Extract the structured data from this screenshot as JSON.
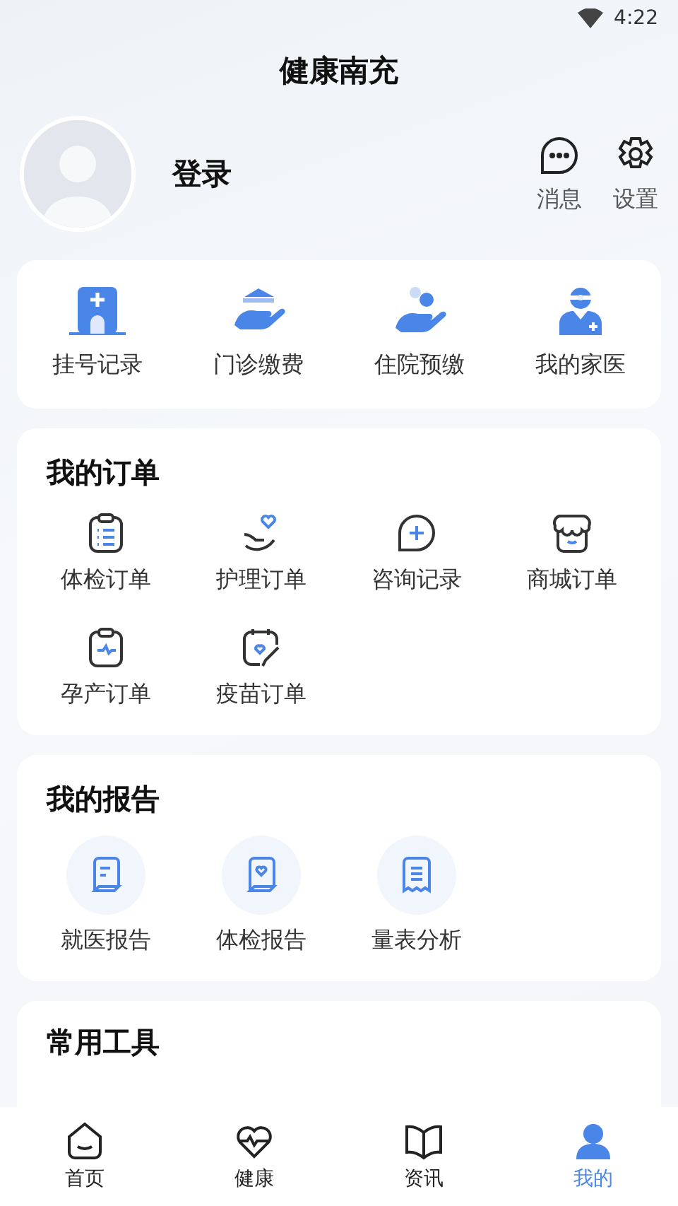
{
  "status_bar": {
    "time": "4:22"
  },
  "title": "健康南充",
  "profile": {
    "login": "登录",
    "actions": [
      {
        "label": "消息"
      },
      {
        "label": "设置"
      }
    ]
  },
  "quick_services": [
    {
      "label": "挂号记录"
    },
    {
      "label": "门诊缴费"
    },
    {
      "label": "住院预缴"
    },
    {
      "label": "我的家医"
    }
  ],
  "orders": {
    "title": "我的订单",
    "items": [
      {
        "label": "体检订单"
      },
      {
        "label": "护理订单"
      },
      {
        "label": "咨询记录"
      },
      {
        "label": "商城订单"
      },
      {
        "label": "孕产订单"
      },
      {
        "label": "疫苗订单"
      }
    ]
  },
  "reports": {
    "title": "我的报告",
    "items": [
      {
        "label": "就医报告"
      },
      {
        "label": "体检报告"
      },
      {
        "label": "量表分析"
      }
    ]
  },
  "tools": {
    "title": "常用工具"
  },
  "bottom_nav": [
    {
      "label": "首页",
      "selected": false
    },
    {
      "label": "健康",
      "selected": false
    },
    {
      "label": "资讯",
      "selected": false
    },
    {
      "label": "我的",
      "selected": true
    }
  ]
}
